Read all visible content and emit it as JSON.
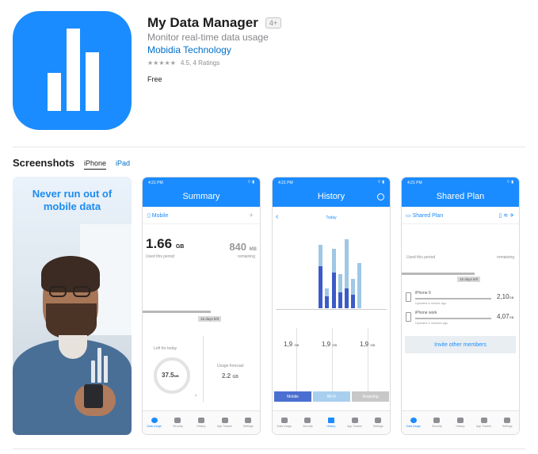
{
  "app": {
    "title": "My Data Manager",
    "age_rating": "4+",
    "subtitle": "Monitor real-time data usage",
    "developer": "Mobidia Technology",
    "stars_display": "★★★★★",
    "rating_text": "4.5, 4 Ratings",
    "price": "Free",
    "icon": "bar-chart-icon",
    "brand_color": "#1a8cff"
  },
  "screenshots": {
    "heading": "Screenshots",
    "tabs": [
      {
        "label": "iPhone",
        "active": true
      },
      {
        "label": "iPad",
        "active": false
      }
    ],
    "promo": {
      "headline_line1": "Never run out of",
      "headline_line2": "mobile data"
    },
    "status_time": "4:21 PM",
    "status_icons": "⌔ ▮",
    "tabbar": [
      "Data Usage",
      "Security",
      "History",
      "App Tracker",
      "Settings"
    ],
    "summary": {
      "title": "Summary",
      "network": "Mobile",
      "used_value": "1.66",
      "used_unit": "GB",
      "used_label": "Used this period",
      "remaining_value": "840",
      "remaining_unit": "MB",
      "remaining_label": "remaining",
      "days_left": "15 days left",
      "left_today_label": "Left for today",
      "left_today_value": "37.5",
      "left_today_unit": "MB",
      "forecast_label": "Usage forecast",
      "forecast_value": "2.2",
      "forecast_unit": "GB",
      "chevron": "›"
    },
    "history": {
      "title": "History",
      "nav_label": "Today",
      "values": [
        "1,9",
        "1,9",
        "1,9"
      ],
      "unit": "GB",
      "buttons": [
        "Mobile",
        "Wi-Fi",
        "Roaming"
      ],
      "back": "‹"
    },
    "shared_plan": {
      "title": "Shared Plan",
      "plan_label": "Shared Plan",
      "used_label": "Used this period",
      "remaining_label": "remaining",
      "days_left": "15 days left",
      "members": [
        {
          "name": "iPhone 6",
          "sub": "Updated a minute ago",
          "value": "2,10",
          "unit": "GB"
        },
        {
          "name": "iPhone work",
          "sub": "Updated 3 minutes ago",
          "value": "4,07",
          "unit": "GB"
        }
      ],
      "invite": "Invite other members"
    }
  }
}
